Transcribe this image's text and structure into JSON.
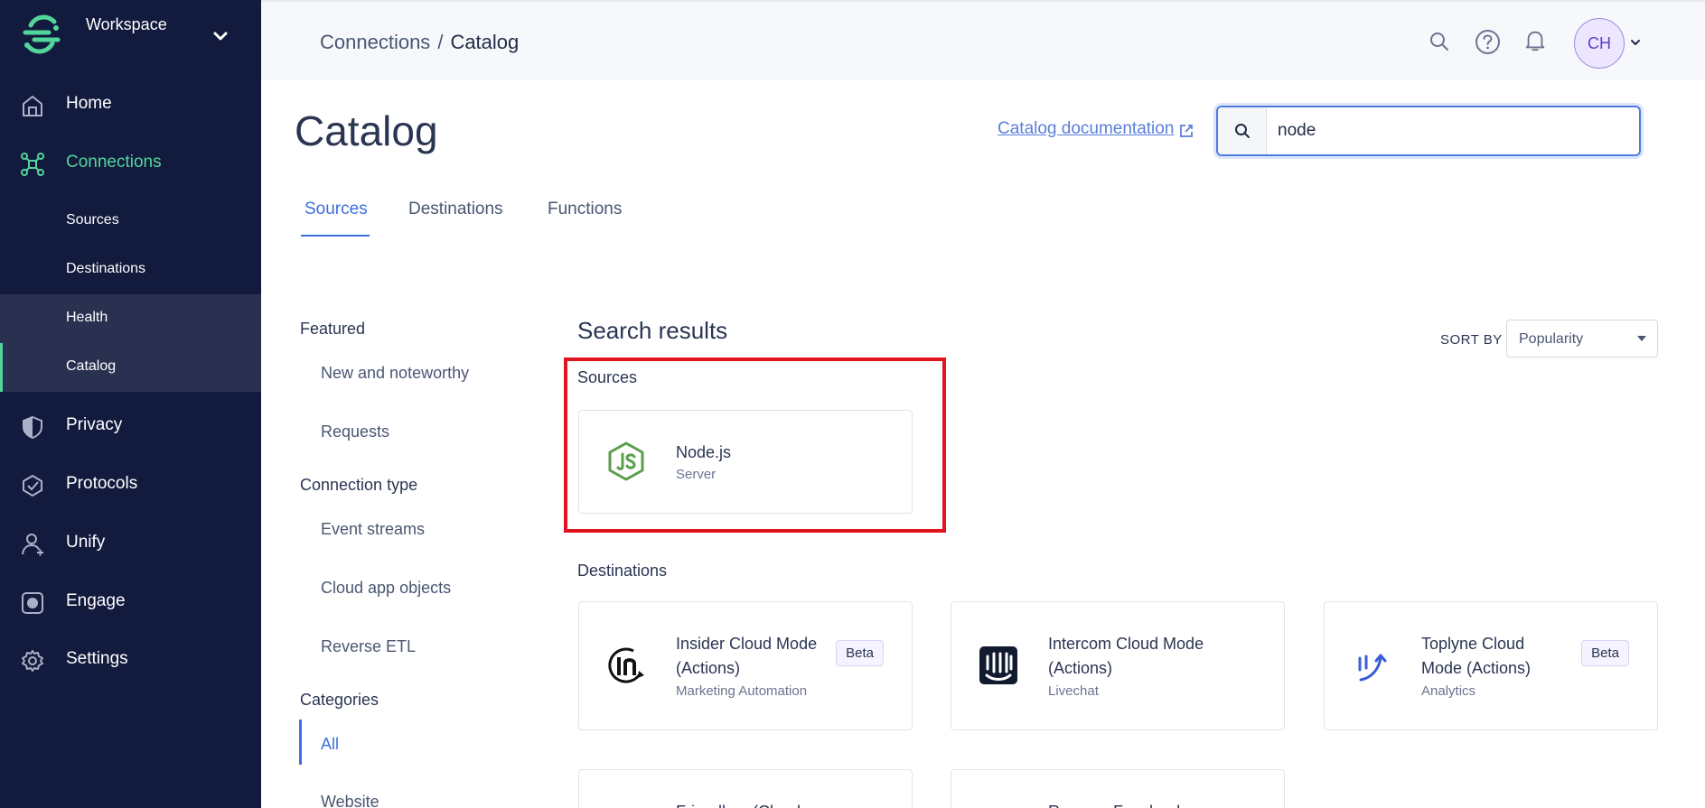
{
  "workspace": {
    "name": "Workspace"
  },
  "nav": {
    "home": "Home",
    "connections": "Connections",
    "sub": {
      "sources": "Sources",
      "destinations": "Destinations",
      "health": "Health",
      "catalog": "Catalog"
    },
    "privacy": "Privacy",
    "protocols": "Protocols",
    "unify": "Unify",
    "engage": "Engage",
    "settings": "Settings"
  },
  "topbar": {
    "breadcrumb": {
      "parent": "Connections",
      "separator": "/",
      "current": "Catalog"
    },
    "avatar_initials": "CH"
  },
  "page": {
    "title": "Catalog",
    "doc_link": "Catalog documentation",
    "search_value": "node"
  },
  "tabs": {
    "sources": "Sources",
    "destinations": "Destinations",
    "functions": "Functions"
  },
  "filters": {
    "featured": "Featured",
    "new_noteworthy": "New and noteworthy",
    "requests": "Requests",
    "connection_type": "Connection type",
    "event_streams": "Event streams",
    "cloud_app_objects": "Cloud app objects",
    "reverse_etl": "Reverse ETL",
    "categories": "Categories",
    "all": "All",
    "website": "Website"
  },
  "results": {
    "title": "Search results",
    "sort_by_label": "SORT BY",
    "sort_value": "Popularity",
    "sources_label": "Sources",
    "destinations_label": "Destinations",
    "sources": [
      {
        "name": "Node.js",
        "category": "Server",
        "icon": "nodejs-icon"
      }
    ],
    "destinations": [
      {
        "name": "Insider Cloud Mode (Actions)",
        "category": "Marketing Automation",
        "badge": "Beta",
        "icon": "insider-icon"
      },
      {
        "name": "Intercom Cloud Mode (Actions)",
        "category": "Livechat",
        "icon": "intercom-icon"
      },
      {
        "name": "Toplyne Cloud Mode (Actions)",
        "category": "Analytics",
        "badge": "Beta",
        "icon": "toplyne-icon"
      },
      {
        "name": "Friendbuy (Cloud",
        "category": "",
        "icon": "friendbuy-icon"
      },
      {
        "name": "Reverse Facebook",
        "category": "",
        "icon": "facebook-icon"
      }
    ]
  },
  "colors": {
    "sidebar": "#121a3d",
    "accent_green": "#52d59b",
    "accent_blue": "#3c6fdf",
    "highlight_red": "#e0141e"
  }
}
